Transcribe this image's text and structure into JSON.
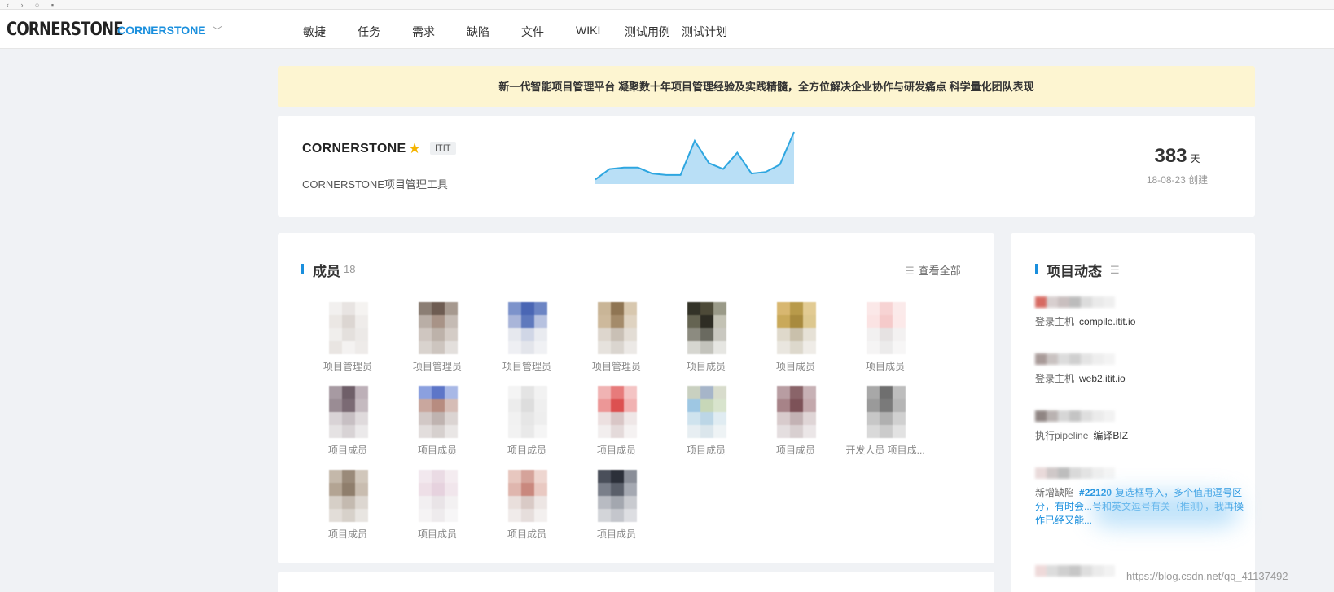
{
  "nav": {
    "logo": "CORNERSTONE",
    "project": "CORNERSTONE",
    "items": [
      {
        "label": "敏捷"
      },
      {
        "label": "任务"
      },
      {
        "label": "需求"
      },
      {
        "label": "缺陷"
      },
      {
        "label": "文件"
      },
      {
        "label": "WIKI"
      },
      {
        "label": "测试用例"
      },
      {
        "label": "测试计划"
      }
    ]
  },
  "notice": "新一代智能项目管理平台 凝聚数十年项目管理经验及实践精髓，全方位解决企业协作与研发痛点 科学量化团队表现",
  "project": {
    "name": "CORNERSTONE",
    "key": "ITIT",
    "description": "CORNERSTONE项目管理工具",
    "days": "383",
    "days_unit": "天",
    "created": "18-08-23 创建",
    "activity_trend": [
      2,
      9,
      10,
      10,
      6,
      5,
      5,
      28,
      13,
      9,
      20,
      6,
      7,
      12,
      34
    ],
    "trend_colors": {
      "line": "#2ea6e0",
      "fill": "#b9dff6"
    }
  },
  "members": {
    "title": "成员",
    "count": "18",
    "view_all": "查看全部",
    "list": [
      {
        "label": "项目管理员",
        "colors": [
          "#f2f0ef",
          "#e8e4e2",
          "#f5f3f1",
          "#ebe7e4",
          "#dcd6d2",
          "#efecea",
          "#f0eeec",
          "#e4e0dd",
          "#ece9e7",
          "#e9e5e2",
          "#f4f2f1",
          "#eeebe9"
        ]
      },
      {
        "label": "项目管理员",
        "colors": [
          "#8b7e74",
          "#6e5c52",
          "#a6998f",
          "#b9aea6",
          "#a89387",
          "#c5bbb4",
          "#cfc6c0",
          "#bdb2aa",
          "#d4ccc6",
          "#d9d3ce",
          "#cdc5bf",
          "#e3dfdc"
        ]
      },
      {
        "label": "项目管理员",
        "colors": [
          "#7d93cb",
          "#4a66b4",
          "#6c85c4",
          "#a9b5d9",
          "#5f79bd",
          "#b7c2e0",
          "#e6e8ee",
          "#d0d6e6",
          "#e9ebf0",
          "#eeeff3",
          "#e3e5eb",
          "#f0f1f4"
        ]
      },
      {
        "label": "项目管理员",
        "colors": [
          "#c9b597",
          "#8f7553",
          "#d8c8af",
          "#cdb99c",
          "#a48b6a",
          "#dfd3c1",
          "#ddd6cd",
          "#c9c0b5",
          "#e3ddd5",
          "#e6e2dd",
          "#dad5cf",
          "#ece9e6"
        ]
      },
      {
        "label": "项目成员",
        "colors": [
          "#333328",
          "#4d4a38",
          "#9a9a88",
          "#656452",
          "#2e2d24",
          "#c3c2b4",
          "#8c8b80",
          "#6a6a60",
          "#c9c8c0",
          "#d6d6d0",
          "#c3c3bc",
          "#e6e6e2"
        ]
      },
      {
        "label": "项目成员",
        "colors": [
          "#d8b770",
          "#b89a4a",
          "#e2cb93",
          "#c9a95a",
          "#a88a3e",
          "#ddc88f",
          "#dfd9cb",
          "#c9c0ab",
          "#e6e1d6",
          "#e9e6df",
          "#ddd8cc",
          "#efece7"
        ]
      },
      {
        "label": "项目成员",
        "colors": [
          "#fbe8e8",
          "#f7d3d3",
          "#fbeaea",
          "#fbe3e3",
          "#f5caca",
          "#fce9e9",
          "#f2f0f0",
          "#e6e2e2",
          "#f3f1f1",
          "#f5f4f4",
          "#ecebeb",
          "#f7f6f6"
        ]
      },
      {
        "label": "项目成员",
        "colors": [
          "#a79aa2",
          "#6f5f69",
          "#bdb0b8",
          "#9a8c94",
          "#7b6a74",
          "#c5bac0",
          "#d9d3d6",
          "#c7bfc3",
          "#dfdadc",
          "#e5e2e3",
          "#d8d3d5",
          "#ebe9ea"
        ]
      },
      {
        "label": "项目成员",
        "colors": [
          "#8ba0df",
          "#5d76c8",
          "#a8b8e6",
          "#c9a79e",
          "#b78c80",
          "#d6bdb6",
          "#d2c8c6",
          "#bfb3b0",
          "#dbd4d2",
          "#e2dddc",
          "#d6d0ce",
          "#e9e6e5"
        ]
      },
      {
        "label": "项目成员",
        "colors": [
          "#f4f4f4",
          "#e4e4e4",
          "#f2f2f2",
          "#ececec",
          "#dddddd",
          "#efefef",
          "#f1f1f1",
          "#e6e6e6",
          "#eeeeee",
          "#f2f2f2",
          "#e9e9e9",
          "#f5f5f5"
        ]
      },
      {
        "label": "项目成员",
        "colors": [
          "#f0b3b3",
          "#e77b7b",
          "#f4c4c4",
          "#ec9797",
          "#dc5050",
          "#f1b2b2",
          "#ece0e0",
          "#d9c6c6",
          "#efe7e7",
          "#f2eeee",
          "#e4dada",
          "#f5f2f2"
        ]
      },
      {
        "label": "项目成员",
        "colors": [
          "#c9d0c0",
          "#a6b5c9",
          "#d8dccc",
          "#9ec7e3",
          "#c7d7b8",
          "#d8e4cd",
          "#cfe3ee",
          "#bcd6e6",
          "#e0ecf2",
          "#e7eef2",
          "#dbe6ec",
          "#eef3f5"
        ]
      },
      {
        "label": "项目成员",
        "colors": [
          "#b89da2",
          "#8a6469",
          "#c7b1b5",
          "#a78388",
          "#7d5258",
          "#c3a8ac",
          "#d8cbcc",
          "#c3b2b4",
          "#dfd5d6",
          "#e4dedf",
          "#d8cfd0",
          "#ebe6e7"
        ]
      },
      {
        "label": "开发人员 项目成...",
        "colors": [
          "#a8a8a8",
          "#6f6f6f",
          "#bdbdbd",
          "#9a9a9a",
          "#7a7a7a",
          "#b5b5b5",
          "#c7c7c7",
          "#b0b0b0",
          "#d0d0d0",
          "#d9d9d9",
          "#cbcbcb",
          "#e2e2e2"
        ]
      },
      {
        "label": "项目成员",
        "colors": [
          "#c4b8aa",
          "#9a8a79",
          "#d1c7bb",
          "#b3a493",
          "#8f7e6c",
          "#c9bdb0",
          "#d6cfc7",
          "#c4bab0",
          "#ddd7d1",
          "#e2ddd8",
          "#d7d1ca",
          "#e8e5e1"
        ]
      },
      {
        "label": "项目成员",
        "colors": [
          "#f2e8ee",
          "#eadbe4",
          "#f4ecf0",
          "#eedfe7",
          "#e6d2de",
          "#f1e6ec",
          "#f2eff1",
          "#e9e4e7",
          "#f3f1f2",
          "#f5f3f4",
          "#eeebed",
          "#f7f6f7"
        ]
      },
      {
        "label": "项目成员",
        "colors": [
          "#e7c7bf",
          "#d5a39a",
          "#eed6d0",
          "#dfb6ae",
          "#c9887e",
          "#e9c9c2",
          "#e9dfdc",
          "#d9cac6",
          "#ede6e4",
          "#f0ebea",
          "#e6dedc",
          "#f3f0ef"
        ]
      },
      {
        "label": "项目成员",
        "colors": [
          "#4a4f5a",
          "#2c303a",
          "#8a8e98",
          "#7a7f8a",
          "#5a5f6a",
          "#a5a9b2",
          "#b8bbc2",
          "#a3a7af",
          "#c9cbd0",
          "#d3d5d9",
          "#c4c6cc",
          "#dddee2"
        ]
      }
    ]
  },
  "activity": {
    "title": "项目动态",
    "items": [
      {
        "colors": [
          "#d76a62",
          "#d8cfcf",
          "#c9bfbf",
          "#bcbcbc",
          "#dcdcdc",
          "#eaeaea",
          "#efefef"
        ],
        "action": "登录主机",
        "value": "compile.itit.io"
      },
      {
        "colors": [
          "#a89a98",
          "#c9c2c1",
          "#dcdcdc",
          "#cfcfcf",
          "#e4e4e4",
          "#eeeeee",
          "#f3f3f3"
        ],
        "action": "登录主机",
        "value": "web2.itit.io"
      },
      {
        "colors": [
          "#8f8583",
          "#b9b2b1",
          "#d6d6d6",
          "#c4c4c4",
          "#dedede",
          "#ebebeb",
          "#f2f2f2"
        ],
        "action": "执行pipeline",
        "value": "编译BIZ"
      },
      {
        "colors": [
          "#e9dada",
          "#cfc8c8",
          "#bdbdbd",
          "#d9d9d9",
          "#e3e3e3",
          "#eeeeee",
          "#f4f4f4"
        ],
        "action": "新增缺陷",
        "link": "#22120",
        "value": "复选框导入，多个值用逗号区分，有时会...号和英文逗号有关（推测），我再操作已经又能..."
      },
      {
        "colors": [
          "#eed9d9",
          "#dcdcdc",
          "#cfcfcf",
          "#c6c6c6",
          "#dedede",
          "#ebebeb",
          "#f2f2f2"
        ],
        "action": "",
        "value": ""
      }
    ]
  },
  "watermark": "https://blog.csdn.net/qq_41137492"
}
